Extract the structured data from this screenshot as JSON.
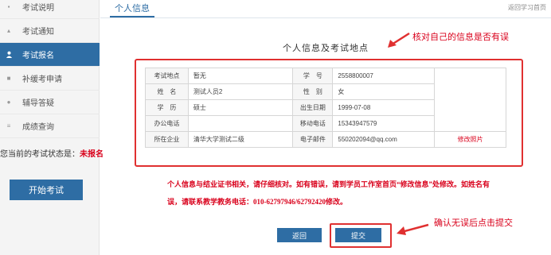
{
  "sidebar": {
    "items": [
      {
        "label": "考试说明",
        "icon": "document-icon"
      },
      {
        "label": "考试通知",
        "icon": "bell-icon"
      },
      {
        "label": "考试报名",
        "icon": "user-icon",
        "active": true
      },
      {
        "label": "补缓考申请",
        "icon": "square-icon"
      },
      {
        "label": "辅导答疑",
        "icon": "question-icon"
      },
      {
        "label": "成绩查询",
        "icon": "list-icon"
      }
    ],
    "status_label": "您当前的考试状态是：",
    "status_value": "未报名",
    "start_button": "开始考试"
  },
  "header": {
    "tab": "个人信息",
    "back_link": "返回学习首页"
  },
  "form": {
    "title": "个人信息及考试地点",
    "rows": [
      {
        "l1": "考试地点",
        "v1": "暂无",
        "l2": "学　号",
        "v2": "2558800007"
      },
      {
        "l1": "姓　名",
        "v1": "测试人员2",
        "l2": "性　别",
        "v2": "女"
      },
      {
        "l1": "学　历",
        "v1": "硕士",
        "l2": "出生日期",
        "v2": "1999-07-08"
      },
      {
        "l1": "办公电话",
        "v1": "",
        "l2": "移动电话",
        "v2": "15343947579"
      },
      {
        "l1": "所在企业",
        "v1": "清华大学测试二级",
        "l2": "电子邮件",
        "v2": "550202094@qq.com"
      }
    ],
    "photo_link": "修改照片",
    "notice_line1": "个人信息与结业证书相关，请仔细核对。如有错误，请到学员工作室首页“修改信息”处修改。如姓名有",
    "notice_line2": "误，请联系教学教务电话：010-62797946/62792420修改。",
    "back_button": "返回",
    "submit_button": "提交"
  },
  "annotations": {
    "top": "核对自己的信息是否有误",
    "bottom": "确认无误后点击提交"
  },
  "colors": {
    "accent": "#2e6da4",
    "annotation_red": "#d9001b",
    "frame_red": "#e03030"
  }
}
